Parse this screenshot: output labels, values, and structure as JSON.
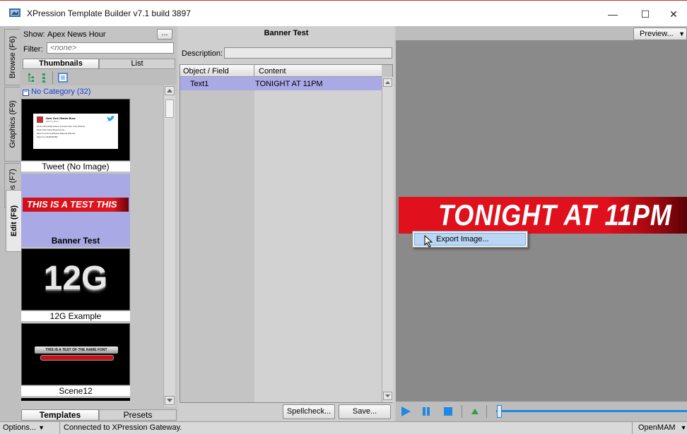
{
  "window": {
    "title": "XPression Template Builder v7.1 build 3897",
    "minimize": "—",
    "maximize": "☐",
    "close": "✕"
  },
  "sidetabs": [
    "Browse (F6)",
    "Graphics (F9)",
    "Clips (F7)",
    "Edit (F8)"
  ],
  "browser": {
    "show_label": "Show:",
    "show_value": "Apex News Hour",
    "ellipsis": "...",
    "filter_label": "Filter:",
    "filter_value": "<none>",
    "view_tabs": [
      "Thumbnails",
      "List"
    ],
    "category": "No Category (32)",
    "items": [
      {
        "caption": "Tweet (No Image)"
      },
      {
        "caption": "Banner Test",
        "banner_text": "THIS IS A TEST THIS"
      },
      {
        "caption": "12G Example",
        "big_text": "12G"
      },
      {
        "caption": "Scene12",
        "bar_text": "THIS IS A TEST OF THE NAME FONT"
      }
    ],
    "tweet": {
      "name": "New York Giants Buzz",
      "handle": "@NYG_Buzz",
      "line1": "Here's #Football season preview New York #Giants",
      "line2": "Rules NFL Plans Business lis...",
      "line3": "https://t.co/xc.hjn/Giants #Sports #Gooos",
      "line4": "https://t.co/3sBSl7bB0"
    },
    "bottom_tabs": [
      "Templates",
      "Presets"
    ]
  },
  "editor": {
    "title": "Banner Test",
    "description_label": "Description:",
    "columns": [
      "Object / Field",
      "Content"
    ],
    "rows": [
      {
        "field": "Text1",
        "content": "TONIGHT AT 11PM"
      }
    ],
    "spellcheck": "Spellcheck...",
    "save": "Save..."
  },
  "preview": {
    "dropdown": "Preview...",
    "banner_text": "TONIGHT AT 11PM",
    "context_item": "Export Image..."
  },
  "status": {
    "options": "Options...",
    "message": "Connected to XPression Gateway.",
    "openmam": "OpenMAM"
  },
  "colors": {
    "accent": "#e0101c",
    "selection": "#a9a9e6",
    "play": "#1e88e5",
    "green": "#2ea043"
  }
}
